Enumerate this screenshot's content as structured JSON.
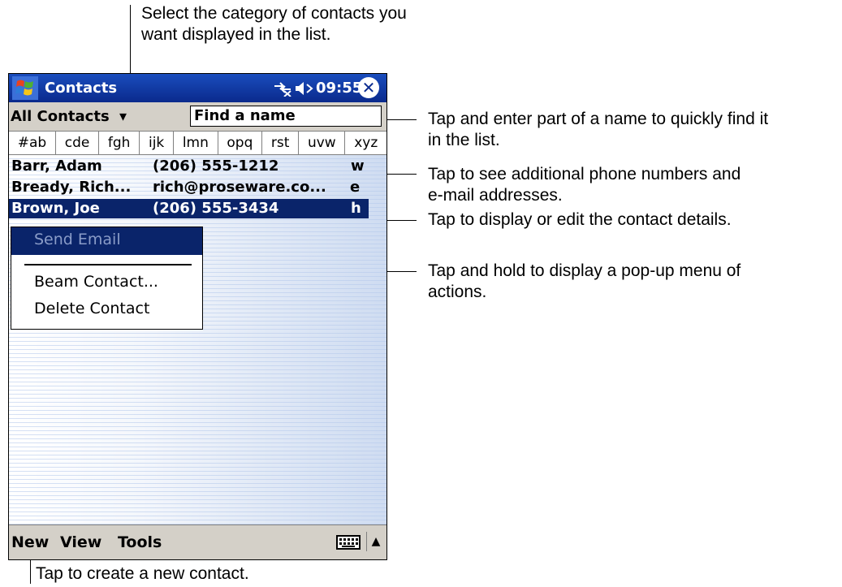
{
  "callouts": {
    "category": "Select the category of contacts you\nwant displayed in the list.",
    "find": "Tap and enter part of a name to quickly find it\nin the list.",
    "phone": "Tap to see additional phone numbers and\ne-mail addresses.",
    "details": "Tap to display or edit the contact details.",
    "hold": "Tap and hold to display a pop-up menu of\nactions.",
    "new": "Tap to create a new contact."
  },
  "titlebar": {
    "title": "Contacts",
    "time": "09:55",
    "close_glyph": "✕"
  },
  "toolbar": {
    "category": "All Contacts",
    "category_arrow": "▾",
    "find_placeholder": "Find a name"
  },
  "alpha_tabs": [
    "#ab",
    "cde",
    "fgh",
    "ijk",
    "lmn",
    "opq",
    "rst",
    "uvw",
    "xyz"
  ],
  "contacts": [
    {
      "name": "Barr, Adam",
      "detail": "(206) 555-1212",
      "type": "w"
    },
    {
      "name": "Bready, Rich...",
      "detail": "rich@proseware.co...",
      "type": "e"
    },
    {
      "name": "Brown, Joe",
      "detail": "(206) 555-3434",
      "type": "h"
    }
  ],
  "popup_menu": {
    "send_email": "Send Email",
    "beam": "Beam Contact...",
    "delete": "Delete Contact"
  },
  "menubar": {
    "new": "New",
    "view": "View",
    "tools": "Tools",
    "sip_arrow": "▲"
  },
  "icons": {
    "start": "windows-start-icon",
    "connectivity": "connectivity-icon",
    "speaker": "speaker-icon",
    "close": "close-icon",
    "keyboard": "keyboard-icon"
  },
  "colors": {
    "titlebar": "#0a2a8c",
    "selection": "#0a246a",
    "toolbar": "#d4d0c8"
  }
}
